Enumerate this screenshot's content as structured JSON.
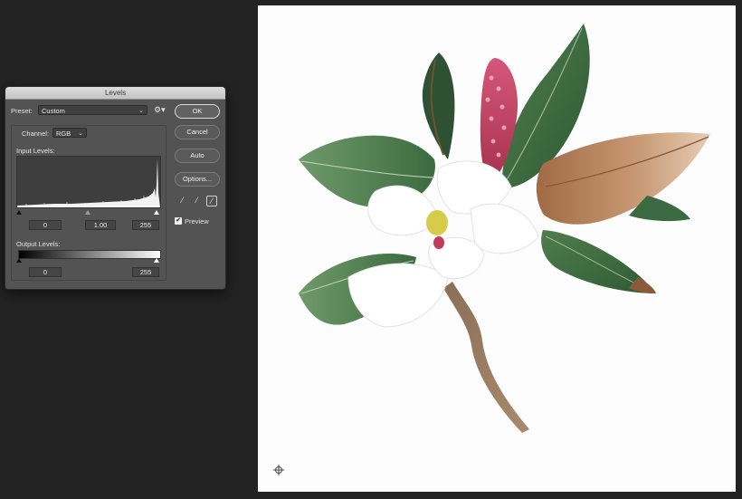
{
  "dialog": {
    "title": "Levels",
    "preset_label": "Preset:",
    "preset_value": "Custom",
    "channel_label": "Channel:",
    "channel_value": "RGB",
    "input_levels_label": "Input Levels:",
    "input_black": "0",
    "input_gamma": "1.00",
    "input_white": "255",
    "output_levels_label": "Output Levels:",
    "output_black": "0",
    "output_white": "255",
    "ok_label": "OK",
    "cancel_label": "Cancel",
    "auto_label": "Auto",
    "options_label": "Options...",
    "preview_label": "Preview",
    "preview_checked": true,
    "gear_icon": "gear-icon",
    "chevron_icon": "chevron-down-icon",
    "check_glyph": "✔"
  },
  "canvas": {
    "subject": "watercolor magnolia",
    "cursor_icon": "crosshair-icon"
  },
  "colors": {
    "app_bg": "#232323",
    "dialog_bg": "#535353",
    "canvas_bg": "#fdfdfd"
  }
}
